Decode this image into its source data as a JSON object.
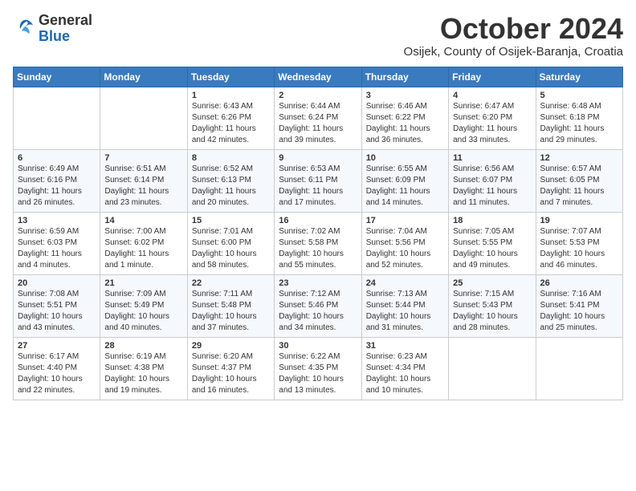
{
  "header": {
    "logo_general": "General",
    "logo_blue": "Blue",
    "month_title": "October 2024",
    "location": "Osijek, County of Osijek-Baranja, Croatia"
  },
  "days_of_week": [
    "Sunday",
    "Monday",
    "Tuesday",
    "Wednesday",
    "Thursday",
    "Friday",
    "Saturday"
  ],
  "weeks": [
    [
      {
        "day": "",
        "sunrise": "",
        "sunset": "",
        "daylight": ""
      },
      {
        "day": "",
        "sunrise": "",
        "sunset": "",
        "daylight": ""
      },
      {
        "day": "1",
        "sunrise": "Sunrise: 6:43 AM",
        "sunset": "Sunset: 6:26 PM",
        "daylight": "Daylight: 11 hours and 42 minutes."
      },
      {
        "day": "2",
        "sunrise": "Sunrise: 6:44 AM",
        "sunset": "Sunset: 6:24 PM",
        "daylight": "Daylight: 11 hours and 39 minutes."
      },
      {
        "day": "3",
        "sunrise": "Sunrise: 6:46 AM",
        "sunset": "Sunset: 6:22 PM",
        "daylight": "Daylight: 11 hours and 36 minutes."
      },
      {
        "day": "4",
        "sunrise": "Sunrise: 6:47 AM",
        "sunset": "Sunset: 6:20 PM",
        "daylight": "Daylight: 11 hours and 33 minutes."
      },
      {
        "day": "5",
        "sunrise": "Sunrise: 6:48 AM",
        "sunset": "Sunset: 6:18 PM",
        "daylight": "Daylight: 11 hours and 29 minutes."
      }
    ],
    [
      {
        "day": "6",
        "sunrise": "Sunrise: 6:49 AM",
        "sunset": "Sunset: 6:16 PM",
        "daylight": "Daylight: 11 hours and 26 minutes."
      },
      {
        "day": "7",
        "sunrise": "Sunrise: 6:51 AM",
        "sunset": "Sunset: 6:14 PM",
        "daylight": "Daylight: 11 hours and 23 minutes."
      },
      {
        "day": "8",
        "sunrise": "Sunrise: 6:52 AM",
        "sunset": "Sunset: 6:13 PM",
        "daylight": "Daylight: 11 hours and 20 minutes."
      },
      {
        "day": "9",
        "sunrise": "Sunrise: 6:53 AM",
        "sunset": "Sunset: 6:11 PM",
        "daylight": "Daylight: 11 hours and 17 minutes."
      },
      {
        "day": "10",
        "sunrise": "Sunrise: 6:55 AM",
        "sunset": "Sunset: 6:09 PM",
        "daylight": "Daylight: 11 hours and 14 minutes."
      },
      {
        "day": "11",
        "sunrise": "Sunrise: 6:56 AM",
        "sunset": "Sunset: 6:07 PM",
        "daylight": "Daylight: 11 hours and 11 minutes."
      },
      {
        "day": "12",
        "sunrise": "Sunrise: 6:57 AM",
        "sunset": "Sunset: 6:05 PM",
        "daylight": "Daylight: 11 hours and 7 minutes."
      }
    ],
    [
      {
        "day": "13",
        "sunrise": "Sunrise: 6:59 AM",
        "sunset": "Sunset: 6:03 PM",
        "daylight": "Daylight: 11 hours and 4 minutes."
      },
      {
        "day": "14",
        "sunrise": "Sunrise: 7:00 AM",
        "sunset": "Sunset: 6:02 PM",
        "daylight": "Daylight: 11 hours and 1 minute."
      },
      {
        "day": "15",
        "sunrise": "Sunrise: 7:01 AM",
        "sunset": "Sunset: 6:00 PM",
        "daylight": "Daylight: 10 hours and 58 minutes."
      },
      {
        "day": "16",
        "sunrise": "Sunrise: 7:02 AM",
        "sunset": "Sunset: 5:58 PM",
        "daylight": "Daylight: 10 hours and 55 minutes."
      },
      {
        "day": "17",
        "sunrise": "Sunrise: 7:04 AM",
        "sunset": "Sunset: 5:56 PM",
        "daylight": "Daylight: 10 hours and 52 minutes."
      },
      {
        "day": "18",
        "sunrise": "Sunrise: 7:05 AM",
        "sunset": "Sunset: 5:55 PM",
        "daylight": "Daylight: 10 hours and 49 minutes."
      },
      {
        "day": "19",
        "sunrise": "Sunrise: 7:07 AM",
        "sunset": "Sunset: 5:53 PM",
        "daylight": "Daylight: 10 hours and 46 minutes."
      }
    ],
    [
      {
        "day": "20",
        "sunrise": "Sunrise: 7:08 AM",
        "sunset": "Sunset: 5:51 PM",
        "daylight": "Daylight: 10 hours and 43 minutes."
      },
      {
        "day": "21",
        "sunrise": "Sunrise: 7:09 AM",
        "sunset": "Sunset: 5:49 PM",
        "daylight": "Daylight: 10 hours and 40 minutes."
      },
      {
        "day": "22",
        "sunrise": "Sunrise: 7:11 AM",
        "sunset": "Sunset: 5:48 PM",
        "daylight": "Daylight: 10 hours and 37 minutes."
      },
      {
        "day": "23",
        "sunrise": "Sunrise: 7:12 AM",
        "sunset": "Sunset: 5:46 PM",
        "daylight": "Daylight: 10 hours and 34 minutes."
      },
      {
        "day": "24",
        "sunrise": "Sunrise: 7:13 AM",
        "sunset": "Sunset: 5:44 PM",
        "daylight": "Daylight: 10 hours and 31 minutes."
      },
      {
        "day": "25",
        "sunrise": "Sunrise: 7:15 AM",
        "sunset": "Sunset: 5:43 PM",
        "daylight": "Daylight: 10 hours and 28 minutes."
      },
      {
        "day": "26",
        "sunrise": "Sunrise: 7:16 AM",
        "sunset": "Sunset: 5:41 PM",
        "daylight": "Daylight: 10 hours and 25 minutes."
      }
    ],
    [
      {
        "day": "27",
        "sunrise": "Sunrise: 6:17 AM",
        "sunset": "Sunset: 4:40 PM",
        "daylight": "Daylight: 10 hours and 22 minutes."
      },
      {
        "day": "28",
        "sunrise": "Sunrise: 6:19 AM",
        "sunset": "Sunset: 4:38 PM",
        "daylight": "Daylight: 10 hours and 19 minutes."
      },
      {
        "day": "29",
        "sunrise": "Sunrise: 6:20 AM",
        "sunset": "Sunset: 4:37 PM",
        "daylight": "Daylight: 10 hours and 16 minutes."
      },
      {
        "day": "30",
        "sunrise": "Sunrise: 6:22 AM",
        "sunset": "Sunset: 4:35 PM",
        "daylight": "Daylight: 10 hours and 13 minutes."
      },
      {
        "day": "31",
        "sunrise": "Sunrise: 6:23 AM",
        "sunset": "Sunset: 4:34 PM",
        "daylight": "Daylight: 10 hours and 10 minutes."
      },
      {
        "day": "",
        "sunrise": "",
        "sunset": "",
        "daylight": ""
      },
      {
        "day": "",
        "sunrise": "",
        "sunset": "",
        "daylight": ""
      }
    ]
  ]
}
